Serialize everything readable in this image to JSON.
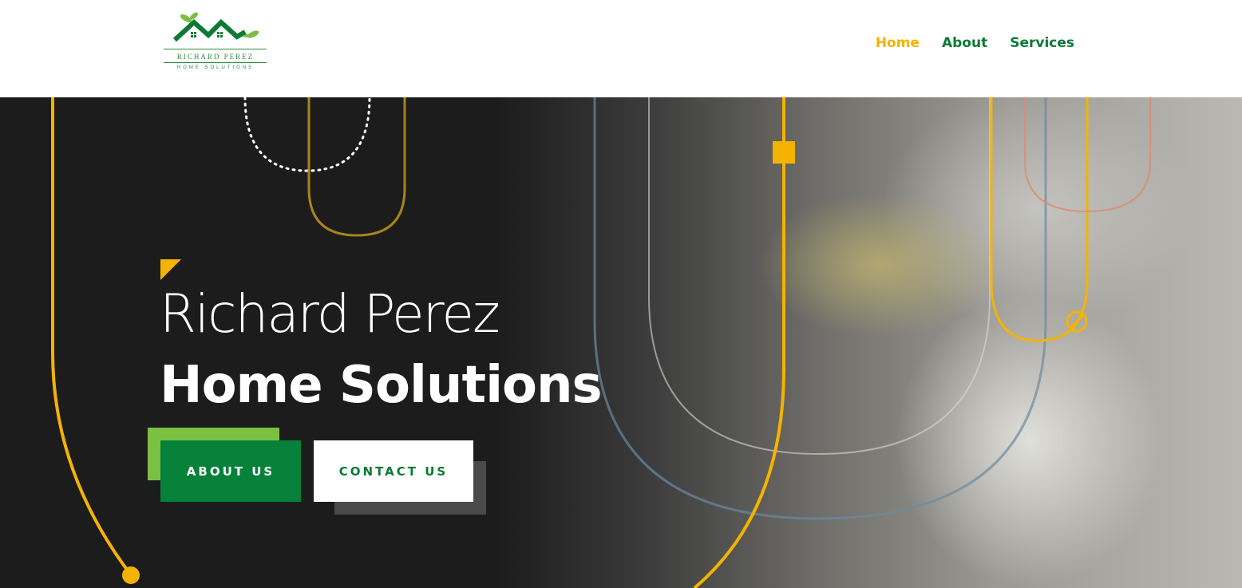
{
  "brand": {
    "logo_name": "RICHARD PEREZ",
    "logo_subtitle": "HOME SOLUTIONS"
  },
  "nav": {
    "items": [
      {
        "label": "Home",
        "active": true
      },
      {
        "label": "About",
        "active": false
      },
      {
        "label": "Services",
        "active": false
      }
    ]
  },
  "hero": {
    "title_light": "Richard Perez",
    "title_bold": "Home Solutions",
    "buttons": {
      "about_label": "ABOUT US",
      "contact_label": "CONTACT US"
    }
  },
  "colors": {
    "brand_green": "#05813a",
    "accent_yellow": "#f5b301",
    "light_green": "#7cc043",
    "hero_dark": "#1c1c1c"
  }
}
